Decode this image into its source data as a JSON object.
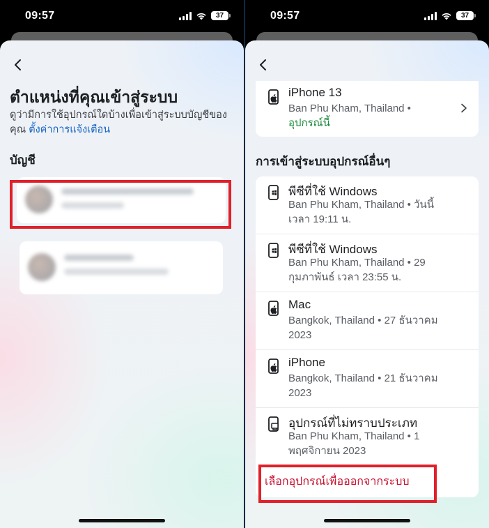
{
  "status": {
    "time": "09:57",
    "battery": "37"
  },
  "left": {
    "title": "ตำแหน่งที่คุณเข้าสู่ระบบ",
    "description": "ดูว่ามีการใช้อุปกรณ์ใดบ้างเพื่อเข้าสู่ระบบบัญชีของคุณ",
    "alert_link": "ตั้งค่าการแจ้งเตือน",
    "accounts_heading": "บัญชี"
  },
  "right": {
    "current_device": {
      "name": "iPhone 13",
      "location": "Ban Phu Kham, Thailand •",
      "tag": "อุปกรณ์นี้",
      "icon": "phone-apple-icon"
    },
    "other_heading": "การเข้าสู่ระบบอุปกรณ์อื่นๆ",
    "devices": [
      {
        "name": "พีซีที่ใช้ Windows",
        "info_line1": "Ban Phu Kham, Thailand • วันนี้",
        "info_line2": "เวลา 19:11 น.",
        "icon": "phone-windows-icon"
      },
      {
        "name": "พีซีที่ใช้ Windows",
        "info_line1": "Ban Phu Kham, Thailand • 29",
        "info_line2": "กุมภาพันธ์ เวลา 23:55 น.",
        "icon": "phone-windows-icon"
      },
      {
        "name": "Mac",
        "info_line1": "Bangkok, Thailand • 27 ธันวาคม",
        "info_line2": "2023",
        "icon": "phone-apple-icon"
      },
      {
        "name": "iPhone",
        "info_line1": "Bangkok, Thailand • 21 ธันวาคม",
        "info_line2": "2023",
        "icon": "phone-apple-icon"
      },
      {
        "name": "อุปกรณ์ที่ไม่ทราบประเภท",
        "info_line1": "Ban Phu Kham, Thailand • 1",
        "info_line2": "พฤศจิกายน  2023",
        "icon": "unknown-device-icon"
      }
    ],
    "logout_link": "เลือกอุปกรณ์เพื่อออกจากระบบ"
  },
  "colors": {
    "highlight": "#e0202a",
    "link": "#1463c4",
    "green": "#1d8a3c",
    "logout": "#c8102e"
  }
}
